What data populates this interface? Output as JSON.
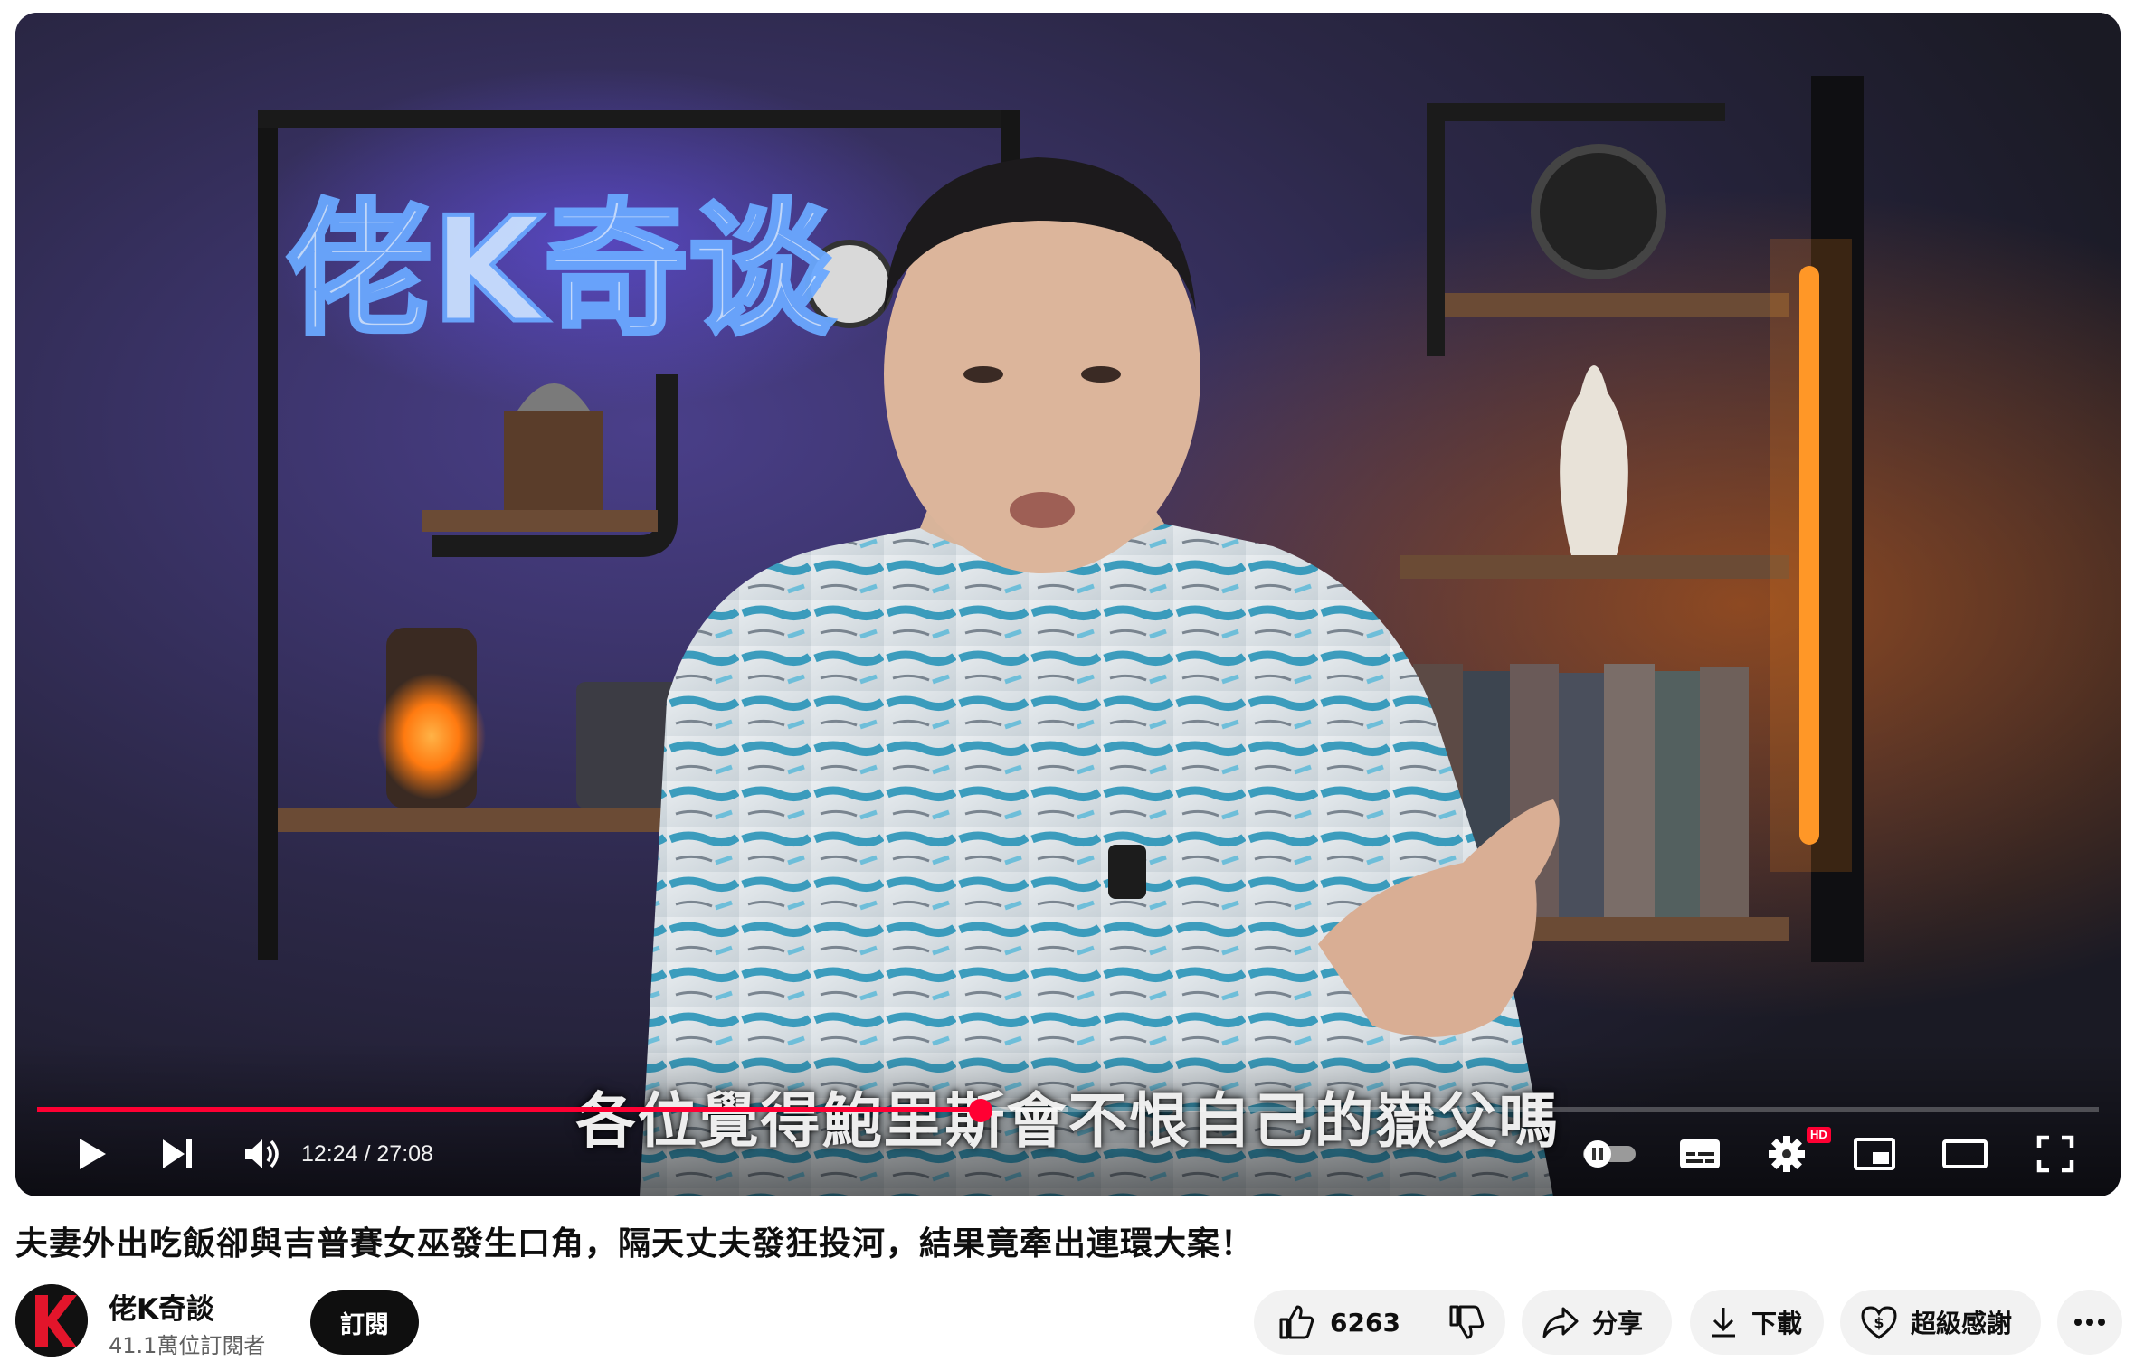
{
  "player": {
    "neon_sign": "佬K奇谈",
    "subtitle": "各位覺得鮑里斯會不恨自己的嶽父嗎",
    "time_display": "12:24 / 27:08",
    "progress_fraction": 0.4577,
    "buffer_fraction": 0.5,
    "hd_badge": "HD",
    "controls": [
      "play-icon",
      "next-icon",
      "volume-icon",
      "autoplay-toggle",
      "captions-icon",
      "settings-icon",
      "miniplayer-icon",
      "theater-icon",
      "fullscreen-icon"
    ]
  },
  "video": {
    "title": "夫妻外出吃飯卻與吉普賽女巫發生口角，隔天丈夫發狂投河，結果竟牽出連環大案！"
  },
  "channel": {
    "name": "佬K奇談",
    "avatar_letter": "K",
    "subscribers": "41.1萬位訂閱者",
    "subscribe_label": "訂閱"
  },
  "actions": {
    "like_count": "6263",
    "share_label": "分享",
    "download_label": "下載",
    "thanks_label": "超級感謝",
    "more_icon": "more-horizontal-icon"
  },
  "colors": {
    "progress_red": "#ff0033",
    "neon_blue": "#6aa8ff",
    "neon_pink": "#ff3cc8",
    "lamp_orange": "#ff8a1e"
  }
}
